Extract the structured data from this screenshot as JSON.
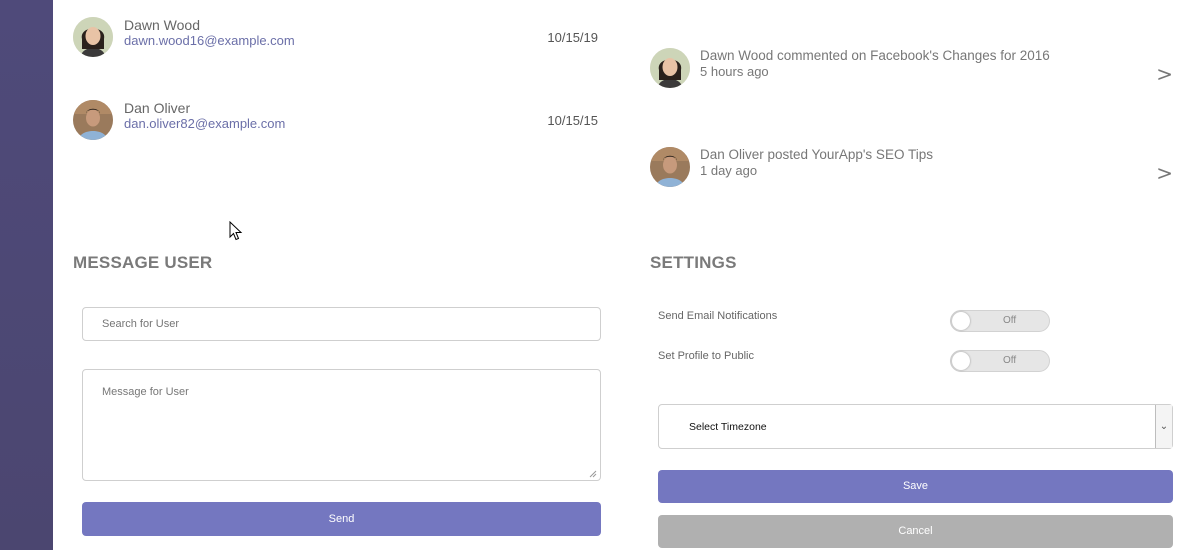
{
  "members": [
    {
      "name": "Dawn Wood",
      "email": "dawn.wood16@example.com",
      "date": "10/15/19",
      "avatar": "woman-avatar"
    },
    {
      "name": "Dan Oliver",
      "email": "dan.oliver82@example.com",
      "date": "10/15/15",
      "avatar": "man-avatar"
    }
  ],
  "activity": [
    {
      "text": "Dawn Wood commented on Facebook's Changes for 2016",
      "time": "5 hours ago",
      "avatar": "woman-avatar",
      "chevron": ">"
    },
    {
      "text": "Dan Oliver posted YourApp's SEO Tips",
      "time": "1 day ago",
      "avatar": "man-avatar",
      "chevron": ">"
    }
  ],
  "message_user": {
    "title": "MESSAGE USER",
    "search_placeholder": "Search for User",
    "message_placeholder": "Message for User",
    "send_label": "Send"
  },
  "settings": {
    "title": "SETTINGS",
    "email_notifications_label": "Send Email Notifications",
    "email_notifications_state": "Off",
    "public_profile_label": "Set Profile to Public",
    "public_profile_state": "Off",
    "timezone_placeholder": "Select Timezone",
    "save_label": "Save",
    "cancel_label": "Cancel"
  },
  "colors": {
    "sidebar": "#4f4a7a",
    "primary_button": "#7477c0",
    "cancel_button": "#b0b0b0",
    "email_link": "#6b6fa8"
  }
}
